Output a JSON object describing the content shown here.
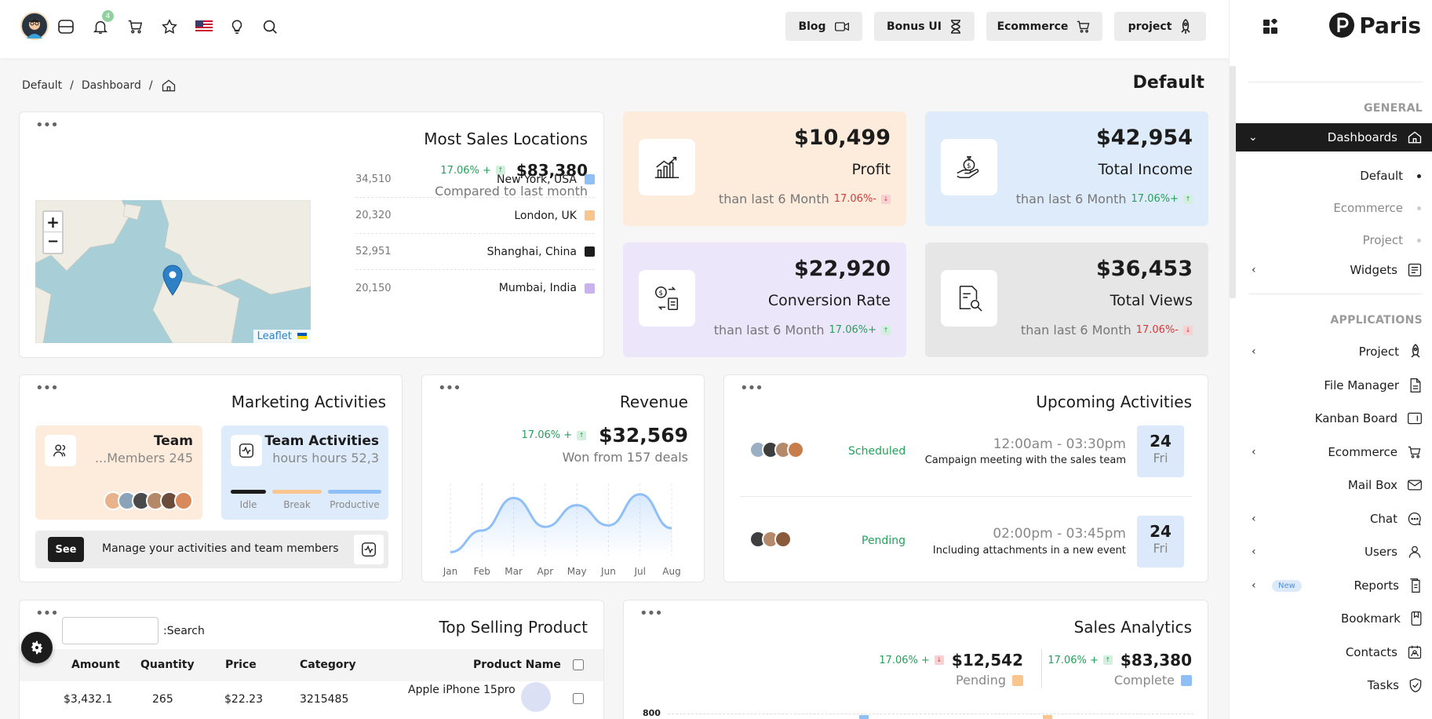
{
  "topbar": {
    "notification_count": "4",
    "buttons": [
      {
        "label": "Blog",
        "icon": "video-camera-icon"
      },
      {
        "label": "Bonus UI",
        "icon": "hourglass-icon"
      },
      {
        "label": "Ecommerce",
        "icon": "cart-icon"
      },
      {
        "label": "project",
        "icon": "rocket-icon"
      }
    ]
  },
  "breadcrumb": {
    "items": [
      "Default",
      "Dashboard"
    ],
    "sep": "/"
  },
  "page_title": "Default",
  "most_sales": {
    "title": "Most Sales Locations",
    "change": "17.06% +",
    "value": "$83,380",
    "compare": "Compared to last month",
    "map_zoom_in": "+",
    "map_zoom_out": "−",
    "map_attribution": "Leaflet",
    "locations": [
      {
        "num": "34,510",
        "city": "New York, USA",
        "color": "#8fbff7"
      },
      {
        "num": "20,320",
        "city": "London, UK",
        "color": "#f9c58e"
      },
      {
        "num": "52,951",
        "city": "Shanghai, China",
        "color": "#1c1c1c"
      },
      {
        "num": "20,150",
        "city": "Mumbai, India",
        "color": "#c9b3ef"
      }
    ]
  },
  "stats": [
    {
      "value": "$10,499",
      "label": "Profit",
      "sub": "than last 6 Month",
      "change": "17.06%-",
      "dir": "down",
      "bg": "#fdebdc"
    },
    {
      "value": "$42,954",
      "label": "Total Income",
      "sub": "than last 6 Month",
      "change": "17.06%+",
      "dir": "up",
      "bg": "#deebfb"
    },
    {
      "value": "$22,920",
      "label": "Conversion Rate",
      "sub": "than last 6 Month",
      "change": "17.06%+",
      "dir": "up",
      "bg": "#ebe6fa"
    },
    {
      "value": "$36,453",
      "label": "Total Views",
      "sub": "than last 6 Month",
      "change": "17.06%-",
      "dir": "down",
      "bg": "#e6e6e6"
    }
  ],
  "marketing": {
    "title": "Marketing Activities",
    "team_title": "Team",
    "team_sub": "...Members 245",
    "activities_title": "Team Activities",
    "activities_sub": "hours hours 52,3",
    "legend": [
      "Idle",
      "Break",
      "Productive"
    ],
    "see_label": "See",
    "manage_text": "Manage your activities and team members"
  },
  "revenue": {
    "title": "Revenue",
    "change": "17.06% +",
    "value": "$32,569",
    "sub": "Won from 157 deals"
  },
  "chart_data": {
    "type": "area",
    "categories": [
      "Jan",
      "Feb",
      "Mar",
      "Apr",
      "May",
      "Jun",
      "Jul",
      "Aug"
    ],
    "values": [
      5,
      35,
      80,
      40,
      70,
      42,
      85,
      38
    ],
    "title": "",
    "xlabel": "",
    "ylabel": "",
    "grid": true
  },
  "upcoming": {
    "title": "Upcoming Activities",
    "items": [
      {
        "status": "Scheduled",
        "time": "12:00am - 03:30pm",
        "desc": "Campaign meeting with the sales team",
        "day": "24",
        "weekday": "Fri"
      },
      {
        "status": "Pending",
        "time": "02:00pm - 03:45pm",
        "desc": "Including attachments in a new event",
        "day": "24",
        "weekday": "Fri"
      }
    ]
  },
  "top_selling": {
    "title": "Top Selling Product",
    "search_label": ":Search",
    "columns": [
      "Amount",
      "Quantity",
      "Price",
      "Category",
      "Product Name"
    ],
    "rows": [
      {
        "amount": "$3,432.1",
        "quantity": "265",
        "price": "$22.23",
        "category": "3215485",
        "product": "Apple iPhone 15pro"
      }
    ]
  },
  "sales_analytics": {
    "title": "Sales Analytics",
    "pending_change": "17.06% +",
    "pending_value": "$12,542",
    "pending_label": "Pending",
    "complete_change": "17.06% +",
    "complete_value": "$83,380",
    "complete_label": "Complete",
    "y_tick": "800"
  },
  "sidebar": {
    "brand": "Paris",
    "general_header": "GENERAL",
    "dashboards": "Dashboards",
    "sub_items": [
      "Default",
      "Ecommerce",
      "Project"
    ],
    "widgets": "Widgets",
    "applications_header": "APPLICATIONS",
    "apps": [
      {
        "label": "Project",
        "chev": true
      },
      {
        "label": "File Manager",
        "chev": false
      },
      {
        "label": "Kanban Board",
        "chev": false
      },
      {
        "label": "Ecommerce",
        "chev": true
      },
      {
        "label": "Mail Box",
        "chev": false
      },
      {
        "label": "Chat",
        "chev": true
      },
      {
        "label": "Users",
        "chev": true
      },
      {
        "label": "Reports",
        "chev": true,
        "badge": "New"
      },
      {
        "label": "Bookmark",
        "chev": false
      },
      {
        "label": "Contacts",
        "chev": false
      },
      {
        "label": "Tasks",
        "chev": false
      }
    ]
  }
}
